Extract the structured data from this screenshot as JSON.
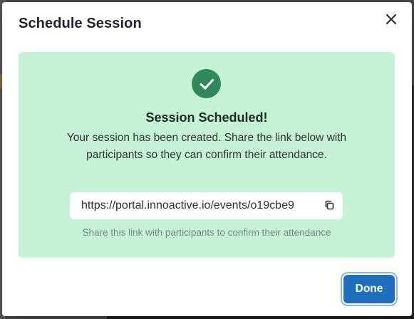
{
  "dialog": {
    "title": "Schedule Session",
    "close_icon": "close-icon",
    "success": {
      "icon": "check-circle-icon",
      "icon_color": "#2f8a5a",
      "panel_color": "#c6f2d5",
      "heading": "Session Scheduled!",
      "message": "Your session has been created. Share the link below with participants so they can confirm their attendance.",
      "link_value": "https://portal.innoactive.io/events/o19cbe9",
      "copy_icon": "copy-icon",
      "helper": "Share this link with participants to confirm their attendance"
    },
    "done_label": "Done",
    "accent_color": "#1f6fbf"
  }
}
